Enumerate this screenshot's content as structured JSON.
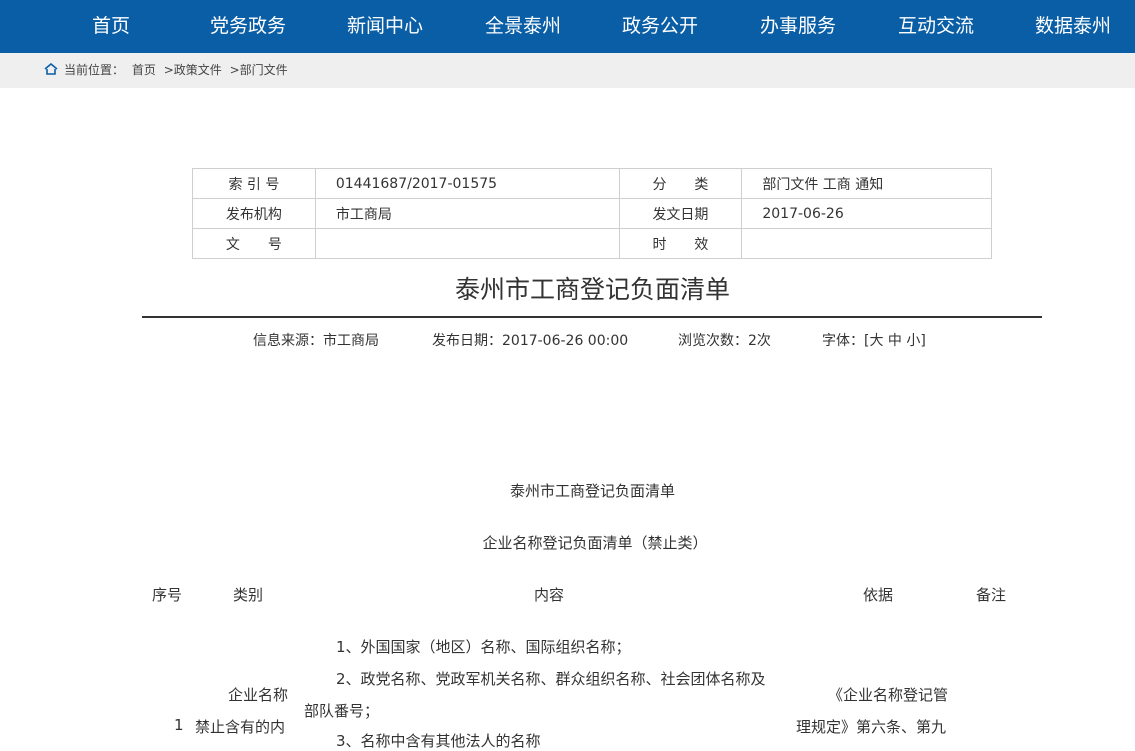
{
  "nav": [
    "首页",
    "党务政务",
    "新闻中心",
    "全景泰州",
    "政务公开",
    "办事服务",
    "互动交流",
    "数据泰州"
  ],
  "breadcrumb": {
    "label": "当前位置：",
    "home": "首页",
    "sep1": ">政策文件",
    "sep2": ">部门文件"
  },
  "meta": {
    "index_label": "索 引 号",
    "index_value": "01441687/2017-01575",
    "category_label": "分　　类",
    "category_value": "部门文件 工商 通知",
    "org_label": "发布机构",
    "org_value": "市工商局",
    "date_label": "发文日期",
    "date_value": "2017-06-26",
    "docno_label": "文　　号",
    "docno_value": "",
    "validity_label": "时　　效",
    "validity_value": ""
  },
  "article": {
    "title": "泰州市工商登记负面清单",
    "source": "信息来源：市工商局",
    "published": "发布日期：2017-06-26 00:00",
    "views": "浏览次数：2次",
    "font_label": "字体：",
    "font_options": "[大 中 小]"
  },
  "content": {
    "heading1": "泰州市工商登记负面清单",
    "heading2": "企业名称登记负面清单（禁止类）",
    "columns": [
      "序号",
      "类别",
      "内容",
      "依据",
      "备注"
    ],
    "row_no": "1",
    "row_category_line1": "企业名称",
    "row_category_line2": "禁止含有的内",
    "line1": "1、外国国家（地区）名称、国际组织名称；",
    "line2a": "2、政党名称、党政军机关名称、群众组织名称、社会团体名称及",
    "line2b": "部队番号；",
    "line3": "3、名称中含有其他法人的名称",
    "basis_line1": "《企业名称登记管",
    "basis_line2": "理规定》第六条、第九"
  }
}
